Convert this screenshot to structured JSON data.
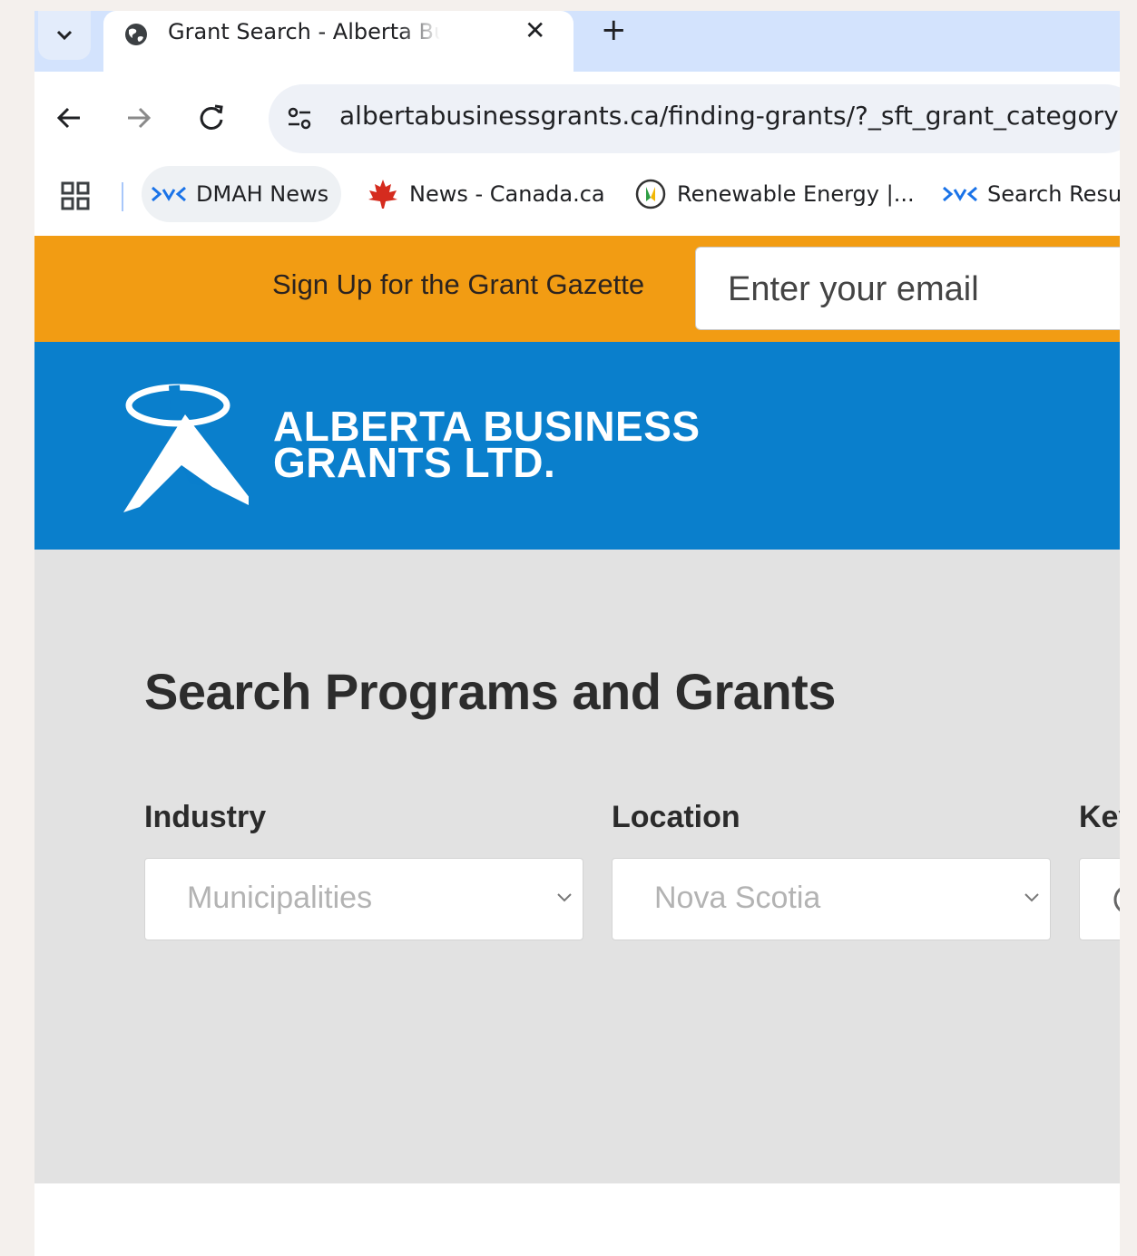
{
  "browser": {
    "tab": {
      "title": "Grant Search - Alberta Business Grants Ltd.",
      "close": "✕"
    },
    "new_tab": "+",
    "url": "albertabusinessgrants.ca/finding-grants/?_sft_grant_category=municipalities&_sft_grant_location=nova-scotia",
    "bookmarks": [
      {
        "label": "DMAH News",
        "icon": "dmah-icon"
      },
      {
        "label": "News - Canada.ca",
        "icon": "maple-leaf-icon"
      },
      {
        "label": "Renewable Energy |...",
        "icon": "renewable-icon"
      },
      {
        "label": "Search Results",
        "icon": "dmah-icon"
      }
    ]
  },
  "newsletter": {
    "label": "Sign Up for the Grant Gazette",
    "email_placeholder": "Enter your email"
  },
  "header": {
    "logo_line1": "ALBERTA BUSINESS",
    "logo_line2": "GRANTS LTD."
  },
  "search": {
    "heading": "Search Programs and Grants",
    "filters": [
      {
        "label": "Industry",
        "value": "Municipalities"
      },
      {
        "label": "Location",
        "value": "Nova Scotia"
      },
      {
        "label": "Keyword",
        "value": ""
      }
    ]
  },
  "colors": {
    "orange_bar": "#f29c13",
    "header_blue": "#0a7fcc",
    "search_bg": "#e2e2e2",
    "tabstrip": "#d3e3fd"
  }
}
